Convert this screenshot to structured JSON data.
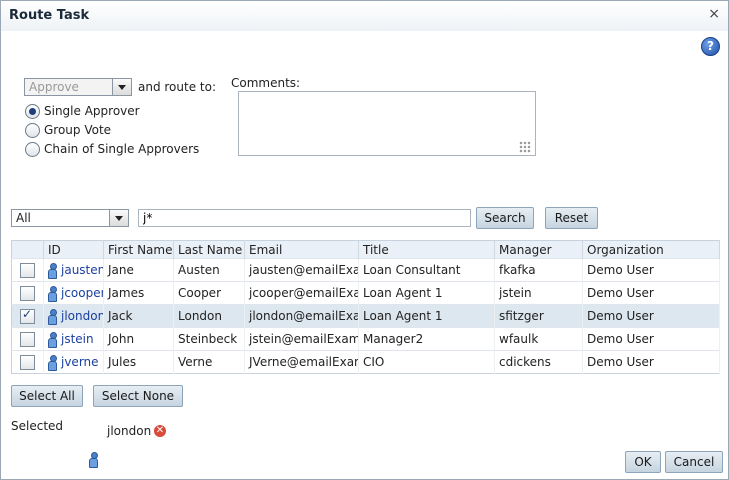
{
  "dialog": {
    "title": "Route Task",
    "close_glyph": "×",
    "help_glyph": "?"
  },
  "routing": {
    "action_value": "Approve",
    "and_route_to": "and route to:",
    "options": [
      {
        "label": "Single Approver",
        "selected": true
      },
      {
        "label": "Group Vote",
        "selected": false
      },
      {
        "label": "Chain of Single Approvers",
        "selected": false
      }
    ],
    "comments_label": "Comments:",
    "comments_value": ""
  },
  "search": {
    "filter_value": "All",
    "query_value": "j*",
    "search_label": "Search",
    "reset_label": "Reset"
  },
  "table": {
    "columns": [
      "ID",
      "First Name",
      "Last Name",
      "Email",
      "Title",
      "Manager",
      "Organization"
    ],
    "rows": [
      {
        "checked": false,
        "id": "jausten",
        "first": "Jane",
        "last": "Austen",
        "email": "jausten@emailExample.com",
        "title": "Loan Consultant",
        "manager": "fkafka",
        "org": "Demo User"
      },
      {
        "checked": false,
        "id": "jcooper",
        "first": "James",
        "last": "Cooper",
        "email": "jcooper@emailExample.com",
        "title": "Loan Agent 1",
        "manager": "jstein",
        "org": "Demo User"
      },
      {
        "checked": true,
        "id": "jlondon",
        "first": "Jack",
        "last": "London",
        "email": "jlondon@emailExample.com",
        "title": "Loan Agent 1",
        "manager": "sfitzger",
        "org": "Demo User"
      },
      {
        "checked": false,
        "id": "jstein",
        "first": "John",
        "last": "Steinbeck",
        "email": "jstein@emailExample.com",
        "title": "Manager2",
        "manager": "wfaulk",
        "org": "Demo User"
      },
      {
        "checked": false,
        "id": "jverne",
        "first": "Jules",
        "last": "Verne",
        "email": "JVerne@emailExample.com",
        "title": "CIO",
        "manager": "cdickens",
        "org": "Demo User"
      }
    ]
  },
  "selection": {
    "select_all_label": "Select All",
    "select_none_label": "Select None",
    "selected_label": "Selected",
    "selected_user": "jlondon"
  },
  "footer": {
    "ok_label": "OK",
    "cancel_label": "Cancel"
  },
  "colors": {
    "button_border": "#8ea4b8",
    "selected_row": "#dde7ef",
    "link": "#1a3f9f"
  }
}
